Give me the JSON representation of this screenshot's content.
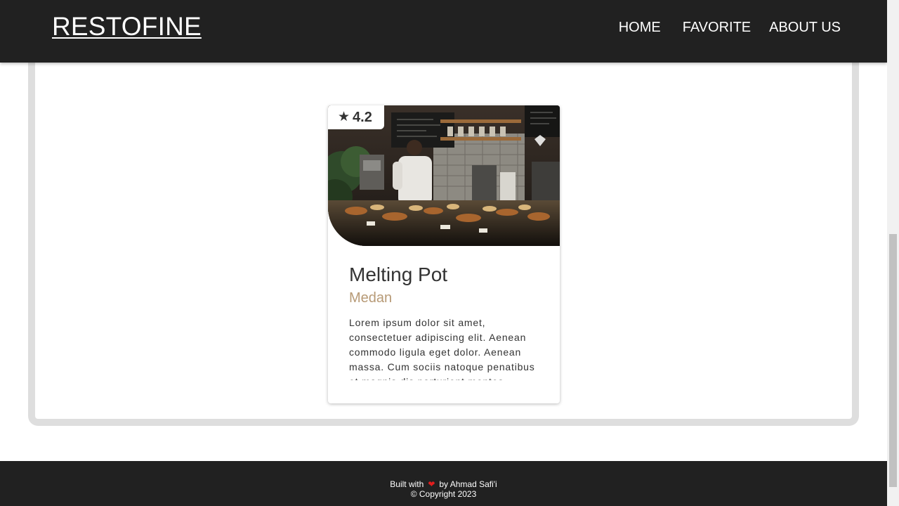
{
  "header": {
    "brand": "RESTOFINE",
    "nav": [
      {
        "label": "HOME"
      },
      {
        "label": "FAVORITE"
      },
      {
        "label": "ABOUT US"
      }
    ]
  },
  "restaurant": {
    "rating_icon": "star-icon",
    "rating": "4.2",
    "name": "Melting Pot",
    "city": "Medan",
    "description": "Lorem ipsum dolor sit amet, consectetuer adipiscing elit. Aenean commodo ligula eget dolor. Aenean massa. Cum sociis natoque penatibus et magnis dis parturient montes, nascetur ridiculus mus."
  },
  "footer": {
    "built_with": "Built with",
    "by": "by Ahmad Safi'i",
    "copyright": "© Copyright 2023",
    "heart_icon": "heart-icon"
  },
  "colors": {
    "header_bg": "#212121",
    "footer_bg": "#212121",
    "city_accent": "#b79a76",
    "panel_border": "#dedede",
    "heart": "#e11d1d"
  }
}
